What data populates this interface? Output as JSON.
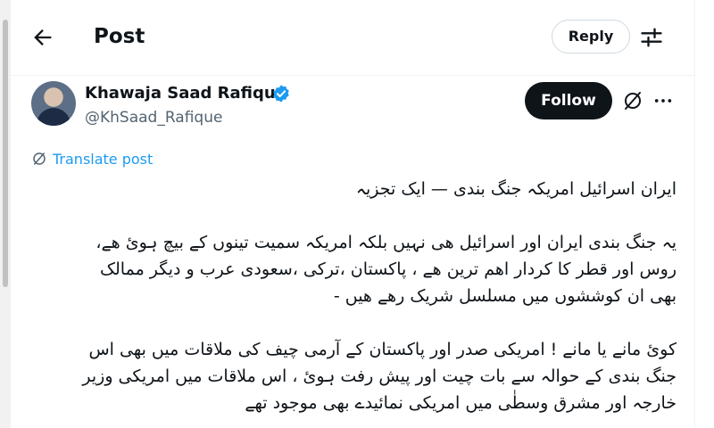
{
  "header": {
    "title": "Post",
    "reply_label": "Reply",
    "back_icon": "arrow-left-icon",
    "filter_icon": "sliders-icon"
  },
  "author": {
    "name": "Khawaja Saad Rafique",
    "handle": "@KhSaad_Rafique",
    "verified": true,
    "verified_color": "#1d9bf0",
    "follow_label": "Follow"
  },
  "actions": {
    "grok_icon": "slash-circle-icon",
    "more_icon": "ellipsis-icon"
  },
  "translate": {
    "label": "Translate post",
    "color": "#1d9bf0"
  },
  "post": {
    "title": "ایران اسرائیل امریکہ جنگ بندی — ایک تجزیہ",
    "paragraph1": [
      "یہ جنگ بندی ایران اور اسرائیل ھی نہیں بلکہ امریکہ سمیت تینوں کے بیچ ہوئ ھے،",
      "روس اور قطر کا کردار اھم ترین ھے ، پاکستان ،ترکی ،سعودی عرب و دیگر ممالک",
      "بھی ان کوششوں میں مسلسل شریک رھے ھیں -"
    ],
    "paragraph2": [
      "کوئ مانے یا مانے ! امریکی صدر اور پاکستان کے آرمی چیف کی ملاقات میں بھی اس",
      "جنگ بندی کے حوالہ سے بات چیت اور پیش رفت ہوئ ، اس ملاقات میں امریکی وزیر",
      "خارجہ اور مشرق وسطٰی میں امریکی نمائیدے بھی موجود تھے"
    ]
  }
}
